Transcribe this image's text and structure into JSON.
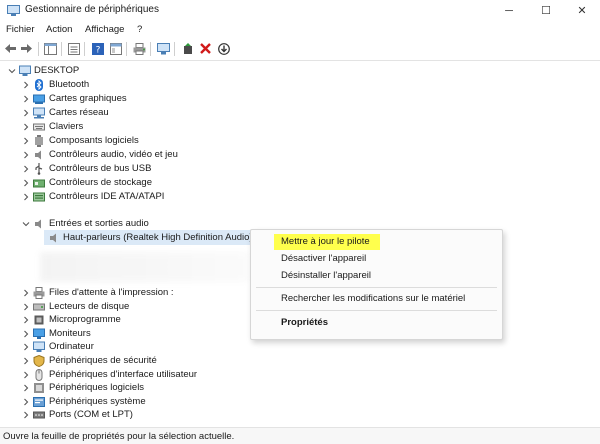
{
  "window": {
    "title": "Gestionnaire de périphériques",
    "minimize": "─",
    "maximize": "☐",
    "close": "✕"
  },
  "menu": [
    "Fichier",
    "Action",
    "Affichage",
    "?"
  ],
  "tree": {
    "root": "DESKTOP",
    "items": [
      {
        "label": "Bluetooth",
        "icon": "bluetooth-icon"
      },
      {
        "label": "Cartes graphiques",
        "icon": "display-adapter-icon"
      },
      {
        "label": "Cartes réseau",
        "icon": "network-adapter-icon"
      },
      {
        "label": "Claviers",
        "icon": "keyboard-icon"
      },
      {
        "label": "Composants logiciels",
        "icon": "software-component-icon"
      },
      {
        "label": "Contrôleurs audio, vidéo et jeu",
        "icon": "audio-controller-icon"
      },
      {
        "label": "Contrôleurs de bus USB",
        "icon": "usb-icon"
      },
      {
        "label": "Contrôleurs de stockage",
        "icon": "storage-controller-icon"
      },
      {
        "label": "Contrôleurs IDE ATA/ATAPI",
        "icon": "ide-controller-icon"
      }
    ],
    "audio_group": {
      "label": "Entrées et sorties audio",
      "child": "Haut-parleurs (Realtek High Definition Audio)"
    },
    "items_after": [
      {
        "label": "Files d'attente à l'impression :",
        "icon": "print-queue-icon"
      },
      {
        "label": "Lecteurs de disque",
        "icon": "disk-drive-icon"
      },
      {
        "label": "Microprogramme",
        "icon": "firmware-icon"
      },
      {
        "label": "Moniteurs",
        "icon": "monitor-icon"
      },
      {
        "label": "Ordinateur",
        "icon": "computer-icon"
      },
      {
        "label": "Périphériques de sécurité",
        "icon": "security-device-icon"
      },
      {
        "label": "Périphériques d'interface utilisateur",
        "icon": "hid-icon"
      },
      {
        "label": "Périphériques logiciels",
        "icon": "software-device-icon"
      },
      {
        "label": "Périphériques système",
        "icon": "system-device-icon"
      },
      {
        "label": "Ports (COM et LPT)",
        "icon": "ports-icon"
      }
    ]
  },
  "context_menu": {
    "update_driver": "Mettre à jour le pilote",
    "disable_device": "Désactiver l'appareil",
    "uninstall_device": "Désinstaller l'appareil",
    "scan_hardware": "Rechercher les modifications sur le matériel",
    "properties": "Propriétés"
  },
  "status": "Ouvre la feuille de propriétés pour la sélection actuelle.",
  "colors": {
    "highlight": "#ffff4d",
    "selection": "#dbe9f7",
    "accent": "#1f6fd1",
    "delete_red": "#d11a1a"
  }
}
